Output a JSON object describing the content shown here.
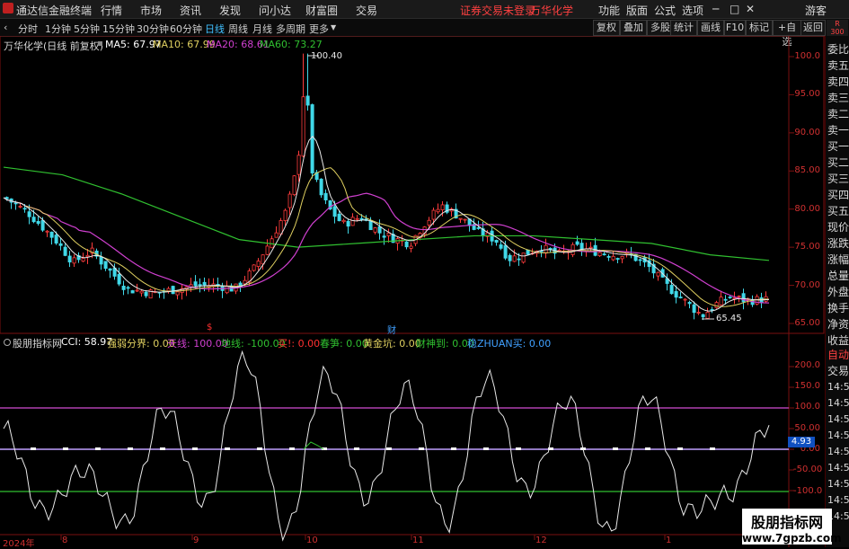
{
  "menubar": {
    "app_title": "通达信金融终端",
    "items": [
      "行情",
      "市场",
      "资讯",
      "发现",
      "问小达",
      "财富圈",
      "交易"
    ],
    "status": "证券交易未登录",
    "stock": "万华化学",
    "right_items": [
      "功能",
      "版面",
      "公式",
      "选项"
    ],
    "guest": "游客"
  },
  "toolbar": {
    "periods": [
      "分时",
      "1分钟",
      "5分钟",
      "15分钟",
      "30分钟",
      "60分钟",
      "日线",
      "周线",
      "月线",
      "多周期",
      "更多"
    ],
    "active_period": "日线",
    "buttons": [
      "复权",
      "叠加",
      "多股",
      "统计",
      "画线",
      "F10",
      "标记",
      "+自选",
      "返回"
    ],
    "r_badge": "R",
    "r_badge_num": "300"
  },
  "price_chart": {
    "title": "万华化学(日线 前复权)",
    "ma": [
      {
        "label": "MA5: 67.97",
        "color": "#ffffff"
      },
      {
        "label": "MA10: 67.99",
        "color": "#e0d060"
      },
      {
        "label": "MA20: 68.61",
        "color": "#d040d0"
      },
      {
        "label": "MA60: 73.27",
        "color": "#30c030"
      }
    ],
    "yticks": [
      "100.0",
      "95.00",
      "90.00",
      "85.00",
      "80.00",
      "75.00",
      "70.00",
      "65.00"
    ],
    "high_label": "100.40",
    "low_label": "65.45",
    "marker_s": "$",
    "marker_cai": "财"
  },
  "indicator": {
    "name": "股朋指标网",
    "values": [
      {
        "label": "CCI: 58.97",
        "color": "#ffffff"
      },
      {
        "label": "强弱分界: 0.00",
        "color": "#e0d060"
      },
      {
        "label": "天线: 100.00",
        "color": "#d040d0"
      },
      {
        "label": "地线: -100.00",
        "color": "#30c030"
      },
      {
        "label": "买!: 0.00",
        "color": "#ff3030"
      },
      {
        "label": "春笋: 0.00",
        "color": "#30c030"
      },
      {
        "label": "黄金坑: 0.00",
        "color": "#e0d060"
      },
      {
        "label": "财神到: 0.00",
        "color": "#30c030"
      },
      {
        "label": "稳ZHUAN买: 0.00",
        "color": "#40a0ff"
      }
    ],
    "yticks": [
      "200.0",
      "150.0",
      "100.0",
      "50.00",
      "0.00",
      "-50.00",
      "-100.0"
    ],
    "current_value": "4.93"
  },
  "xaxis": [
    "2024年",
    "8",
    "9",
    "10",
    "11",
    "12",
    "1"
  ],
  "right_panel": {
    "items": [
      "委比",
      "卖五",
      "卖四",
      "卖三",
      "卖二",
      "卖一",
      "买一",
      "买二",
      "买三",
      "买四",
      "买五",
      "现价",
      "涨跌",
      "涨幅",
      "总量",
      "外盘",
      "换手",
      "净资",
      "收益"
    ],
    "items2": [
      "自动",
      "交易",
      "14:5",
      "14:5",
      "14:5",
      "14:5",
      "14:5",
      "14:5",
      "14:5",
      "14:5",
      "14:5"
    ]
  },
  "watermark": {
    "line1": "股朋指标网",
    "line2": "www.7gpzb.com"
  },
  "chart_data": {
    "type": "line",
    "title": "万华化学(日线 前复权)",
    "x": [
      "2024年",
      "8",
      "9",
      "10",
      "11",
      "12",
      "1"
    ],
    "series": [
      {
        "name": "MA60",
        "values": [
          85.5,
          84.5,
          82,
          79,
          76,
          75,
          75.5,
          76,
          76.5,
          76.5,
          76,
          75.5,
          74,
          73.27
        ]
      },
      {
        "name": "CCI",
        "values": [
          50,
          -150,
          -50,
          -180,
          100,
          -130,
          220,
          -200,
          180,
          -120,
          150,
          -180,
          170,
          -100,
          120,
          -200,
          130,
          -150,
          -110,
          58.97
        ]
      }
    ],
    "ylim_price": [
      63,
      102
    ],
    "ylim_cci": [
      -250,
      250
    ],
    "price_high": 100.4,
    "price_low": 65.45
  }
}
